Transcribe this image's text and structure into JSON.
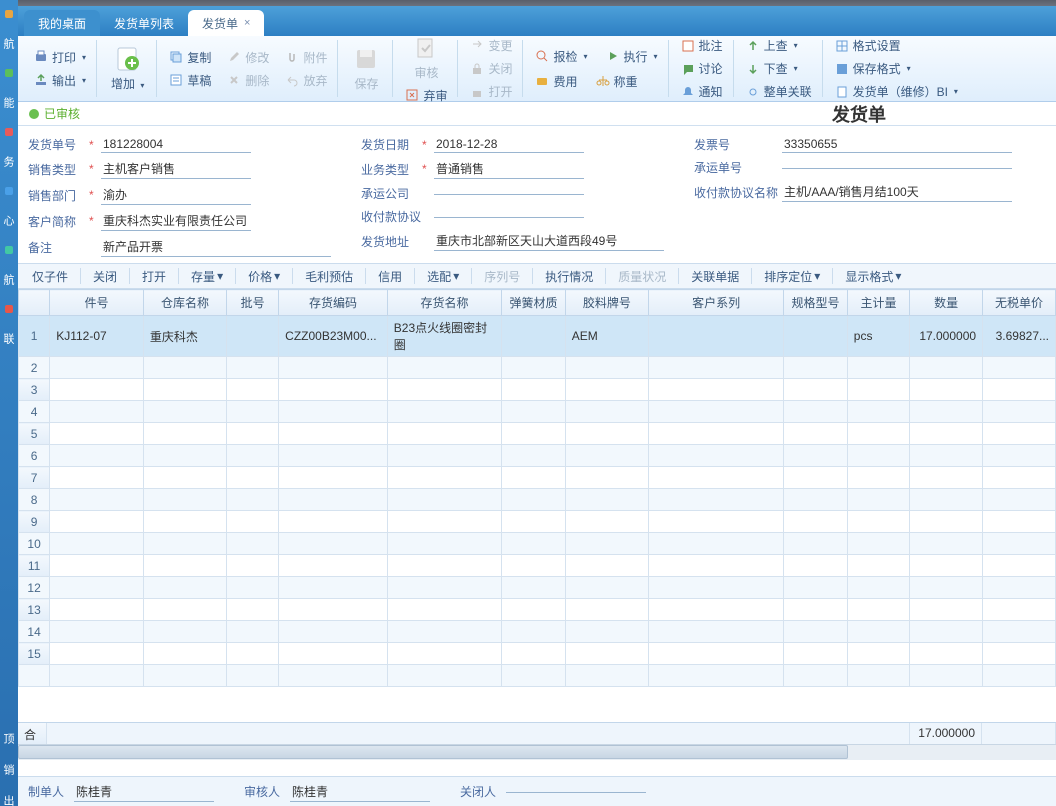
{
  "tabs": {
    "desktop": "我的桌面",
    "list": "发货单列表",
    "detail": "发货单"
  },
  "ribbon": {
    "print": "打印",
    "export": "输出",
    "add": "增加",
    "copy": "复制",
    "modify": "修改",
    "attach": "附件",
    "draft": "草稿",
    "delete": "删除",
    "rollback": "放弃",
    "save": "保存",
    "audit": "审核",
    "abandon": "弃审",
    "change": "变更",
    "close_r": "关闭",
    "open_r": "打开",
    "inspect": "报检",
    "cost": "费用",
    "exec": "执行",
    "weigh": "称重",
    "approve": "批注",
    "discuss": "讨论",
    "notify": "通知",
    "up": "上查",
    "down": "下查",
    "link": "整单关联",
    "fmt_set": "格式设置",
    "save_fmt": "保存格式",
    "repair": "发货单（维修）BI"
  },
  "status": "已审核",
  "doc_title": "发货单",
  "form": {
    "no_label": "发货单号",
    "no": "181228004",
    "sale_type_label": "销售类型",
    "sale_type": "主机客户销售",
    "dept_label": "销售部门",
    "dept": "渝办",
    "cust_label": "客户简称",
    "cust": "重庆科杰实业有限责任公司",
    "remark_label": "备注",
    "remark": "新产品开票",
    "date_label": "发货日期",
    "date": "2018-12-28",
    "biz_label": "业务类型",
    "biz": "普通销售",
    "carrier_label": "承运公司",
    "carrier": "",
    "pay_label": "收付款协议",
    "pay": "",
    "addr_label": "发货地址",
    "addr": "重庆市北部新区天山大道西段49号",
    "inv_label": "发票号",
    "inv": "33350655",
    "waybill_label": "承运单号",
    "waybill": "",
    "payname_label": "收付款协议名称",
    "payname": "主机/AAA/销售月结100天"
  },
  "toolbar2": {
    "only_kit": "仅子件",
    "close": "关闭",
    "open": "打开",
    "stock": "存量",
    "price": "价格",
    "profit": "毛利预估",
    "credit": "信用",
    "match": "选配",
    "serial": "序列号",
    "exec": "执行情况",
    "quality": "质量状况",
    "assoc": "关联单据",
    "sort": "排序定位",
    "display": "显示格式"
  },
  "columns": [
    "件号",
    "仓库名称",
    "批号",
    "存货编码",
    "存货名称",
    "弹簧材质",
    "胶料牌号",
    "客户系列",
    "规格型号",
    "主计量",
    "数量",
    "无税单价"
  ],
  "rows": [
    {
      "kit": "KJ112-07",
      "wh": "重庆科杰",
      "batch": "",
      "code": "CZZ00B23M00...",
      "name": "B23点火线圈密封圈",
      "spring": "",
      "rubber": "AEM",
      "series": "",
      "spec": "",
      "uom": "pcs",
      "qty": "17.000000",
      "price": "3.69827..."
    }
  ],
  "totals": {
    "label": "合计",
    "qty": "17.000000"
  },
  "footer": {
    "maker_label": "制单人",
    "maker": "陈桂青",
    "auditor_label": "审核人",
    "auditor": "陈桂青",
    "closer_label": "关闭人",
    "closer": ""
  }
}
